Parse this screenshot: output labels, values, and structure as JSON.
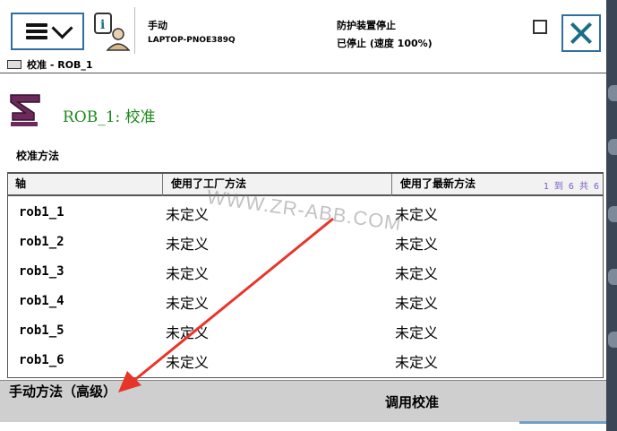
{
  "header": {
    "mode": "手动",
    "controller": "LAPTOP-PNOE389Q",
    "safety_status": "防护装置停止",
    "run_status": "已停止 (速度 100%)"
  },
  "breadcrumb": "校准 - ROB_1",
  "page_title": "ROB_1:  校准",
  "section_label": "校准方法",
  "table": {
    "columns": [
      "轴",
      "使用了工厂方法",
      "使用了最新方法"
    ],
    "count_label": "1 到 6 共 6",
    "rows": [
      {
        "axis": "rob1_1",
        "factory": "未定义",
        "latest": "未定义"
      },
      {
        "axis": "rob1_2",
        "factory": "未定义",
        "latest": "未定义"
      },
      {
        "axis": "rob1_3",
        "factory": "未定义",
        "latest": "未定义"
      },
      {
        "axis": "rob1_4",
        "factory": "未定义",
        "latest": "未定义"
      },
      {
        "axis": "rob1_5",
        "factory": "未定义",
        "latest": "未定义"
      },
      {
        "axis": "rob1_6",
        "factory": "未定义",
        "latest": "未定义"
      }
    ]
  },
  "watermark": "WWW.ZR-ABB.COM",
  "bottom": {
    "manual_method": "手动方法（高级）",
    "call_calibration": "调用校准"
  },
  "colors": {
    "accent_border": "#2f6fa0",
    "title_green": "#1b8a1b",
    "annotation_arrow": "#e8352a"
  },
  "icons": [
    "menu-icon",
    "info-user-icon",
    "window-icon",
    "close-icon",
    "keyboard-icon",
    "robot-calibration-icon"
  ]
}
